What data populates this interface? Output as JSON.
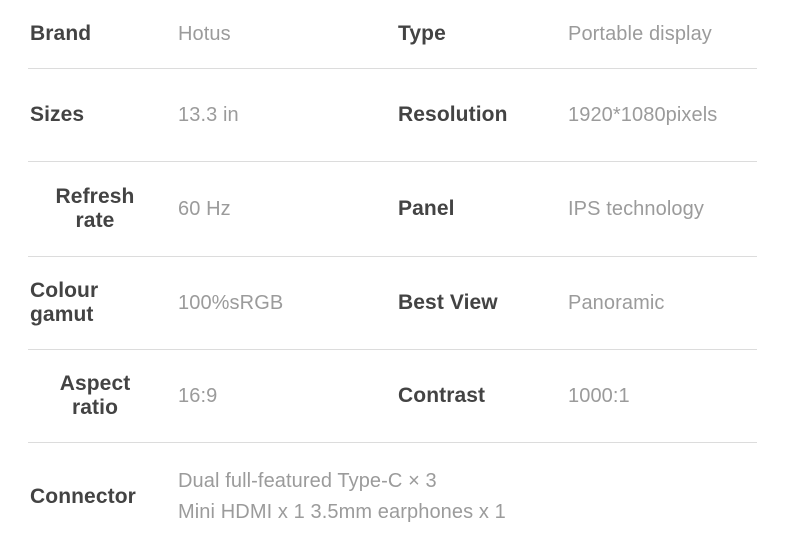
{
  "document": {
    "title": "Product Specification Table",
    "type": "spec-sheet",
    "colors": {
      "background": "#ffffff",
      "label_text": "#434343",
      "value_text": "#9b9b9b",
      "divider": "#dcdcdc"
    }
  },
  "rows": [
    {
      "left": {
        "label": "Brand",
        "value": "Hotus",
        "label_align": "left"
      },
      "right": {
        "label": "Type",
        "value": "Portable display"
      }
    },
    {
      "left": {
        "label": "Sizes",
        "value": "13.3 in",
        "label_align": "left"
      },
      "right": {
        "label": "Resolution",
        "value": "1920*1080pixels"
      }
    },
    {
      "left": {
        "label": "Refresh\nrate",
        "value": "60 Hz",
        "label_align": "center"
      },
      "right": {
        "label": "Panel",
        "value": "IPS technology"
      }
    },
    {
      "left": {
        "label": "Colour\ngamut",
        "value": "100%sRGB",
        "label_align": "left"
      },
      "right": {
        "label": "Best View",
        "value": "Panoramic"
      }
    },
    {
      "left": {
        "label": "Aspect\nratio",
        "value": "16:9",
        "label_align": "center"
      },
      "right": {
        "label": "Contrast",
        "value": "1000:1"
      }
    }
  ],
  "connector_row": {
    "label": "Connector",
    "value_line_1": "Dual full-featured Type-C × 3",
    "value_line_2": "Mini HDMI x 1   3.5mm earphones x 1",
    "value": "Dual full-featured Type-C × 3\nMini HDMI x 1   3.5mm earphones x 1"
  }
}
